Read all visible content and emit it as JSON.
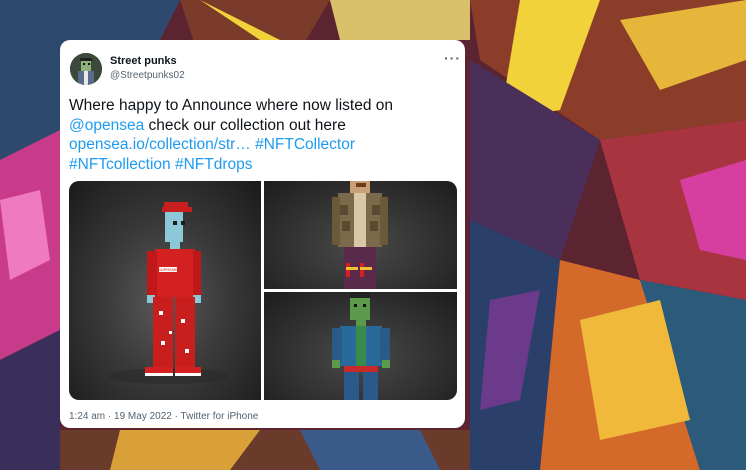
{
  "tweet": {
    "author": {
      "name": "Street punks",
      "handle": "@Streetpunks02"
    },
    "more_glyph": "···",
    "text": {
      "line1": "Where happy to Announce where now listed on",
      "mention": "@opensea",
      "line2_rest": " check our collection out here",
      "url": "opensea.io/collection/str…",
      "tag1": "#NFTCollector",
      "tag2": "#NFTcollection",
      "tag3": "#NFTdrops"
    },
    "media": {
      "tiles": [
        "red-punk-character",
        "jacket-punk-character",
        "green-zombie-punk-character"
      ],
      "shirt_text": "SUPREME"
    },
    "timestamp": "1:24 am · 19 May 2022 · Twitter for iPhone"
  },
  "colors": {
    "link": "#1d9bf0",
    "text": "#0f1419",
    "muted": "#536471"
  }
}
